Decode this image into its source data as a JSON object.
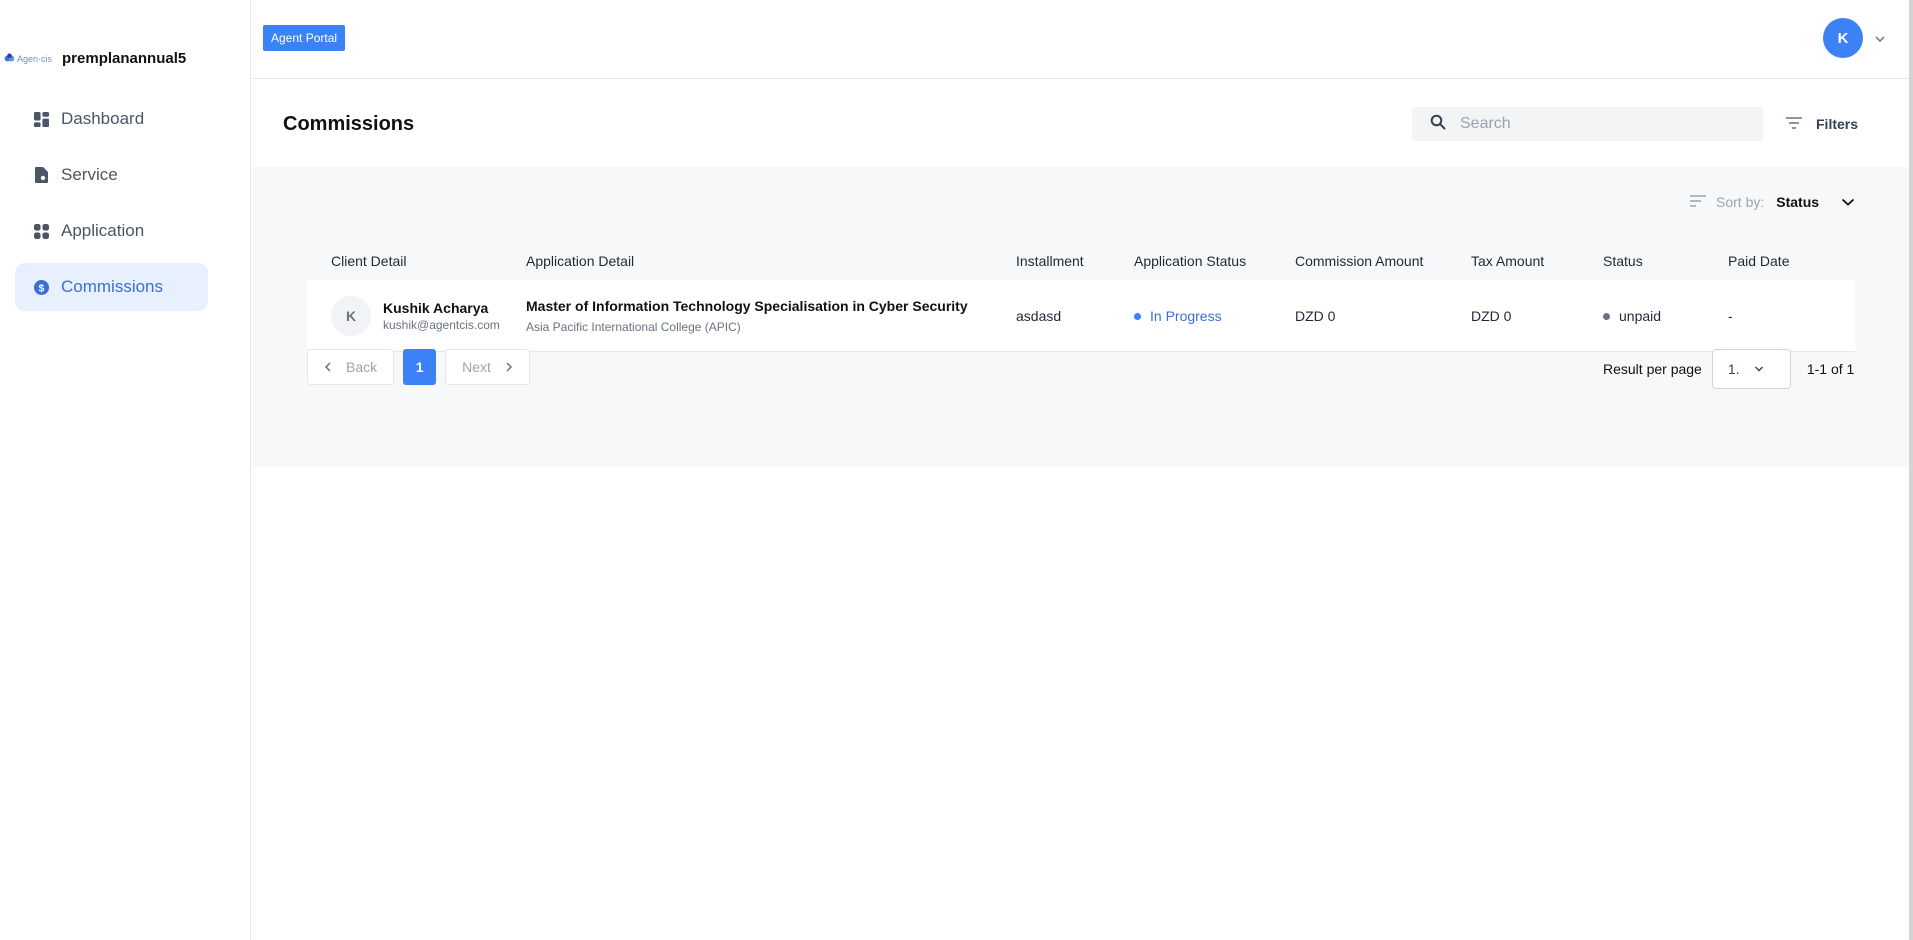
{
  "sidebar": {
    "brand_logo_text": "Agen·cis",
    "brand_name": "premplanannual5",
    "items": [
      {
        "label": "Dashboard",
        "icon": "dashboard-icon",
        "active": false
      },
      {
        "label": "Service",
        "icon": "document-icon",
        "active": false
      },
      {
        "label": "Application",
        "icon": "grid-icon",
        "active": false
      },
      {
        "label": "Commissions",
        "icon": "dollar-icon",
        "active": true
      }
    ]
  },
  "header": {
    "portal_label": "Agent Portal",
    "avatar_initial": "K"
  },
  "page": {
    "title": "Commissions",
    "search_placeholder": "Search",
    "filters_label": "Filters",
    "sort_label": "Sort by:",
    "sort_value": "Status"
  },
  "table": {
    "columns": [
      "Client Detail",
      "Application Detail",
      "Installment",
      "Application Status",
      "Commission Amount",
      "Tax Amount",
      "Status",
      "Paid Date"
    ],
    "rows": [
      {
        "client_initial": "K",
        "client_name": "Kushik Acharya",
        "client_email": "kushik@agentcis.com",
        "application_name": "Master of Information Technology Specialisation in Cyber Security",
        "application_college": "Asia Pacific International College (APIC)",
        "installment": "asdasd",
        "application_status": "In Progress",
        "commission_amount": "DZD 0",
        "tax_amount": "DZD 0",
        "status": "unpaid",
        "paid_date": "-"
      }
    ]
  },
  "pagination": {
    "back_label": "Back",
    "next_label": "Next",
    "current_page": "1",
    "result_per_page_label": "Result per page",
    "per_page_value": "1.",
    "range_text": "1-1 of 1"
  },
  "colors": {
    "accent": "#3b82f6",
    "active_nav_bg": "#e8f0fd",
    "in_progress": "#3b82f6",
    "unpaid_dot": "#6b7280"
  }
}
